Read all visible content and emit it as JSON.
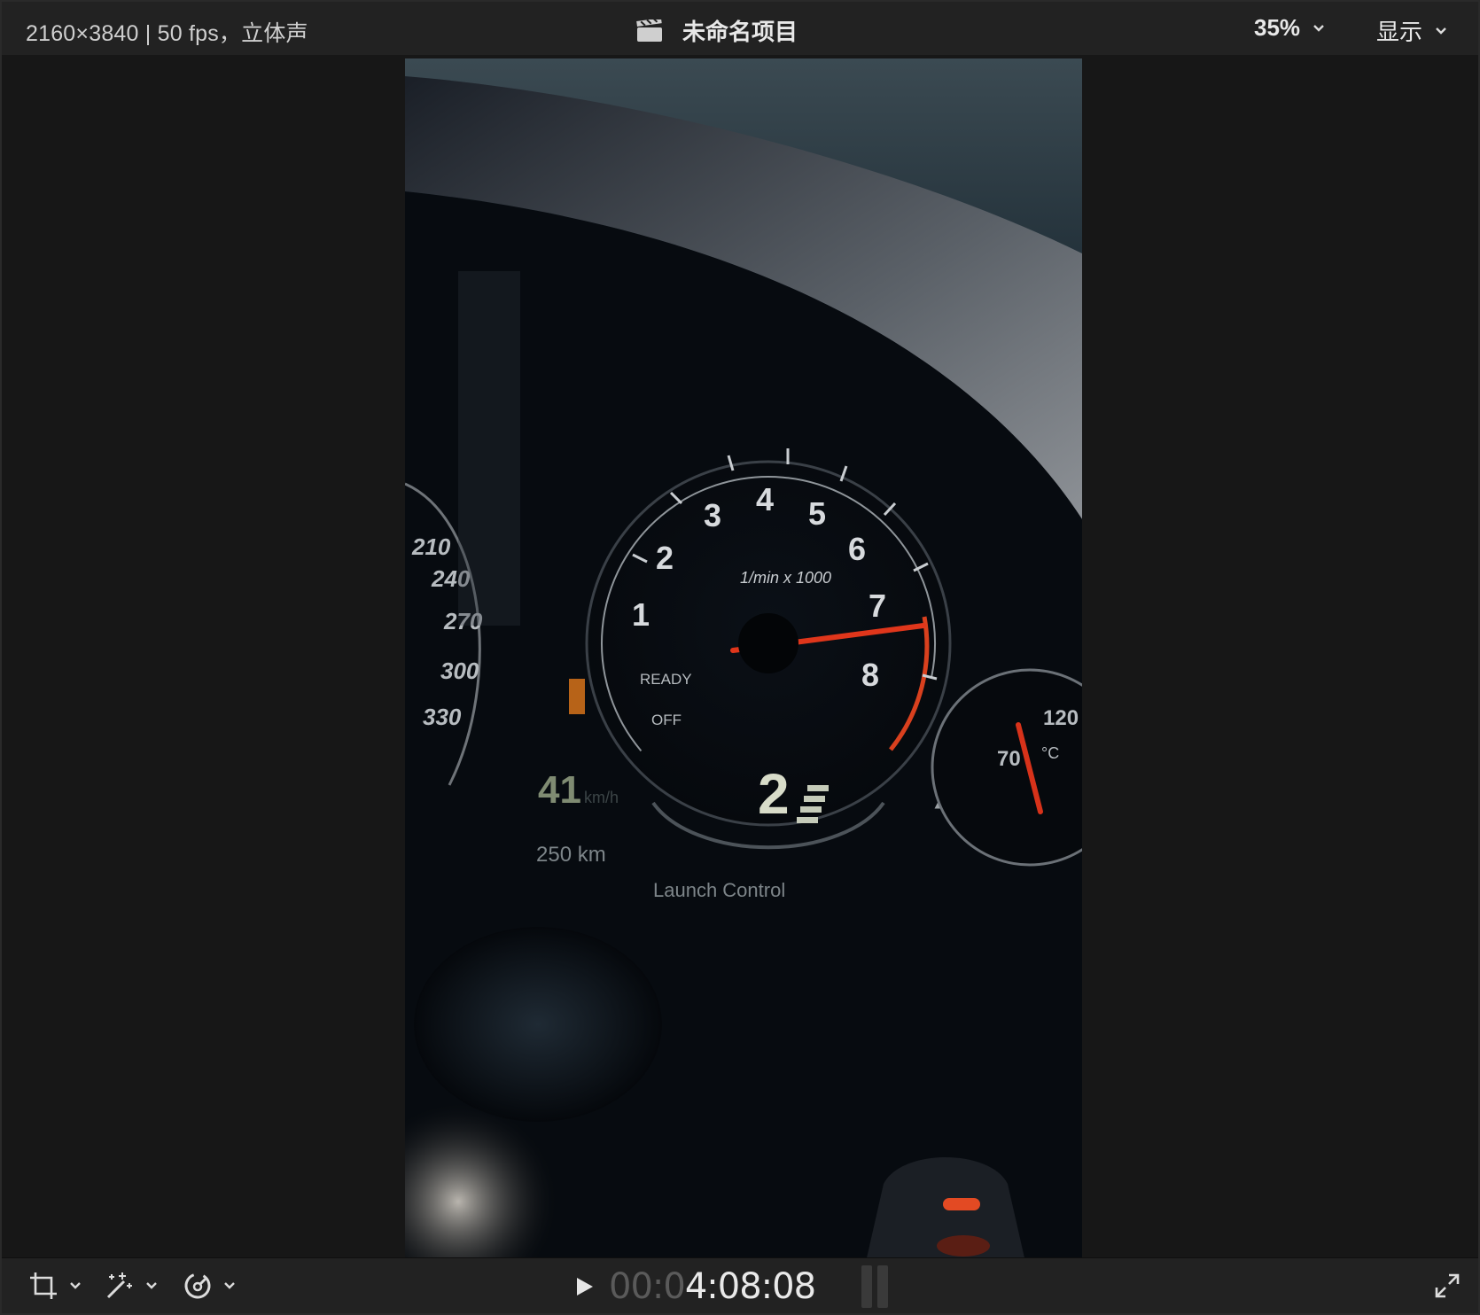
{
  "topbar": {
    "format_info": "2160×3840 | 50 fps，立体声",
    "project_title": "未命名项目",
    "zoom_level": "35%",
    "view_menu": "显示"
  },
  "video_frame": {
    "tachometer": {
      "numbers": [
        "1",
        "2",
        "3",
        "4",
        "5",
        "6",
        "7",
        "8"
      ],
      "unit": "1/min x 1000",
      "ready": "READY",
      "off": "OFF"
    },
    "speedometer": {
      "numbers": [
        "210",
        "240",
        "270",
        "300",
        "330"
      ]
    },
    "speed": "41",
    "speed_unit": "km/h",
    "range": "250 km",
    "gear": "2",
    "launch": "Launch Control",
    "temp_gauge": {
      "low": "70",
      "high": "120",
      "unit": "°C"
    }
  },
  "bottombar": {
    "timecode_dim": "00:0",
    "timecode_bright": "4:08:08"
  },
  "icons": {
    "crop": "crop-icon",
    "enhance": "magic-wand-icon",
    "retime": "speed-gauge-icon",
    "play": "play-icon",
    "fullscreen": "expand-icon",
    "clapper": "clapperboard-icon"
  }
}
